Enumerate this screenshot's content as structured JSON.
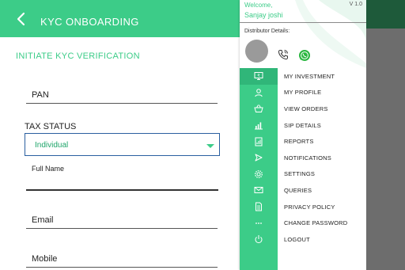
{
  "header": {
    "title": "KYC ONBOARDING"
  },
  "section": {
    "title": "INITIATE KYC VERIFICATION"
  },
  "form": {
    "pan_label": "PAN",
    "tax_status_label": "TAX STATUS",
    "tax_status_value": "Individual",
    "full_name_label": "Full Name",
    "email_label": "Email",
    "mobile_label": "Mobile"
  },
  "drawer": {
    "welcome": "Welcome,",
    "version": "V 1.0",
    "user_name": "Sanjay joshi",
    "distributor_label": "Distributor Details:",
    "items": [
      {
        "label": "MY INVESTMENT",
        "icon": "investment-icon"
      },
      {
        "label": "MY PROFILE",
        "icon": "profile-icon"
      },
      {
        "label": "VIEW ORDERS",
        "icon": "basket-icon"
      },
      {
        "label": "SIP DETAILS",
        "icon": "bar-chart-icon"
      },
      {
        "label": "REPORTS",
        "icon": "report-icon"
      },
      {
        "label": "NOTIFICATIONS",
        "icon": "notification-icon"
      },
      {
        "label": "SETTINGS",
        "icon": "gear-icon"
      },
      {
        "label": "QUERIES",
        "icon": "mail-icon"
      },
      {
        "label": "PRIVACY POLICY",
        "icon": "document-icon"
      },
      {
        "label": "CHANGE PASSWORD",
        "icon": "password-icon"
      },
      {
        "label": "LOGOUT",
        "icon": "power-icon"
      }
    ]
  },
  "colors": {
    "accent": "#3ccc88",
    "overlay": "#6d6d6d"
  }
}
